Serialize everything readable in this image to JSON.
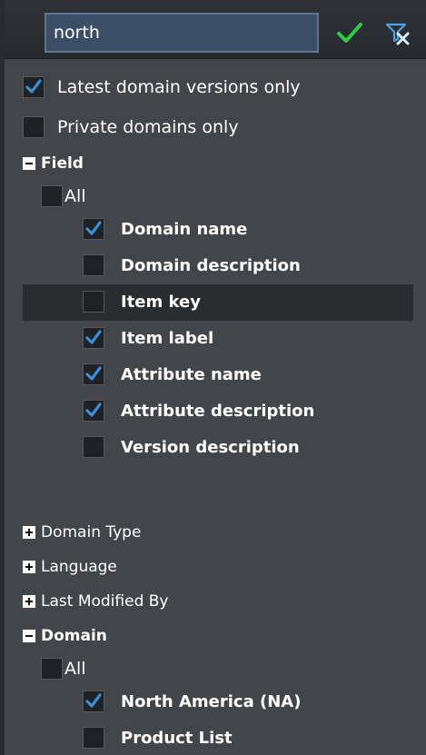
{
  "search": {
    "value": "north"
  },
  "options": {
    "latest_versions": {
      "label": "Latest domain versions only",
      "checked": true
    },
    "private_domains": {
      "label": "Private domains only",
      "checked": false
    }
  },
  "field_section": {
    "title": "Field",
    "expanded": true,
    "all_label": "All",
    "items": [
      {
        "label": "Domain name",
        "checked": true
      },
      {
        "label": "Domain description",
        "checked": false
      },
      {
        "label": "Item key",
        "checked": false,
        "highlighted": true
      },
      {
        "label": "Item label",
        "checked": true
      },
      {
        "label": "Attribute name",
        "checked": true
      },
      {
        "label": "Attribute description",
        "checked": true
      },
      {
        "label": "Version description",
        "checked": false
      }
    ]
  },
  "collapsed_sections": [
    {
      "title": "Domain Type"
    },
    {
      "title": "Language"
    },
    {
      "title": "Last Modified By"
    }
  ],
  "domain_section": {
    "title": "Domain",
    "expanded": true,
    "all_label": "All",
    "items": [
      {
        "label": "North America (NA)",
        "checked": true
      },
      {
        "label": "Product List",
        "checked": false
      }
    ]
  },
  "colors": {
    "background": "#43454a",
    "check": "#3a8fd6",
    "apply": "#2ecc40",
    "highlight": "#2a2c30"
  },
  "icons": {
    "apply": "checkmark-icon",
    "clear": "clear-filter-icon",
    "expand": "plus-box-icon",
    "collapse": "minus-box-icon"
  }
}
